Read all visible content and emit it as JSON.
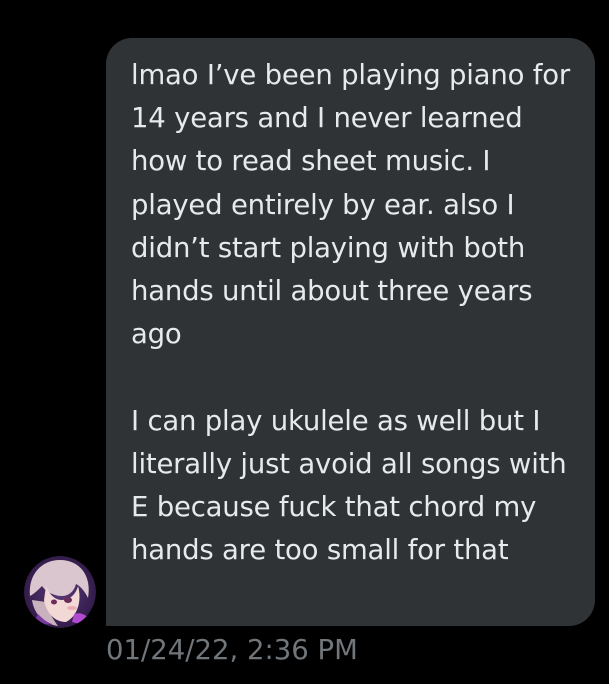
{
  "message": {
    "paragraphs": [
      "lmao I’ve been playing piano for 14 years and I never learned how to read sheet music. I played entirely by ear. also I didn’t start playing with both hands until about three years ago",
      "I can play ukulele as well but I literally just avoid all songs with E because fuck that chord my hands are too small for that"
    ],
    "timestamp": "01/24/22, 2:36 PM"
  },
  "colors": {
    "background": "#000000",
    "bubble": "#2f3336",
    "text": "#e7e9ea",
    "timestamp": "#71767b"
  },
  "sender": {
    "avatar_icon": "user-avatar-illustration"
  }
}
